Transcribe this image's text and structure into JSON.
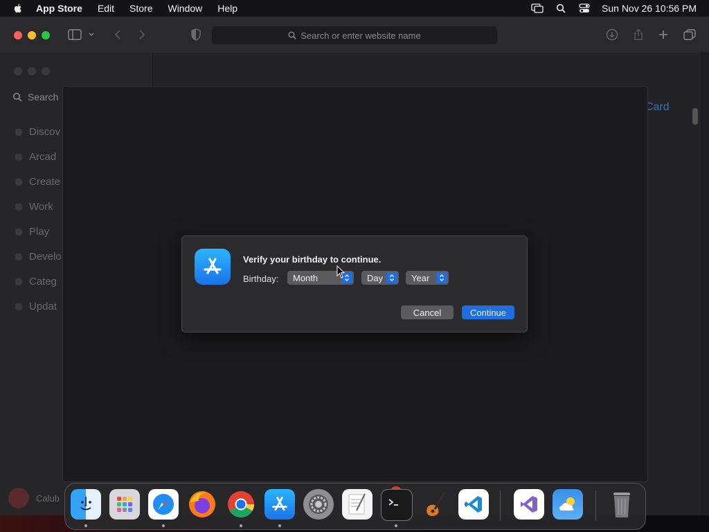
{
  "menubar": {
    "app_name": "App Store",
    "items": [
      "Edit",
      "Store",
      "Window",
      "Help"
    ],
    "clock": "Sun Nov 26  10:56 PM",
    "status_icons": [
      "screen-mirroring-icon",
      "spotlight-search-icon",
      "control-center-icon"
    ]
  },
  "safari": {
    "url_placeholder": "Search or enter website name"
  },
  "appstore": {
    "search_label": "Search",
    "nav": [
      "Discover",
      "Arcade",
      "Create",
      "Work",
      "Play",
      "Develop",
      "Categories",
      "Updates"
    ],
    "nav_visible": [
      "Discov",
      "Arcad",
      "Create",
      "Work",
      "Play",
      "Develo",
      "Categ",
      "Updat"
    ],
    "card_text": "Card",
    "user_name": "Calub"
  },
  "dialog": {
    "title": "Verify your birthday to continue.",
    "birthday_label": "Birthday:",
    "month_value": "Month",
    "day_value": "Day",
    "year_value": "Year",
    "cancel_label": "Cancel",
    "continue_label": "Continue",
    "accent": "#1f6ee0"
  },
  "dock": {
    "apps": [
      "Finder",
      "Launchpad",
      "Safari",
      "Firefox",
      "Chrome",
      "App Store",
      "System Settings",
      "TextEdit",
      "Terminal",
      "GarageBand",
      "Visual Studio Code",
      "Visual Studio",
      "Weather",
      "Trash"
    ],
    "settings_badge": "1"
  }
}
